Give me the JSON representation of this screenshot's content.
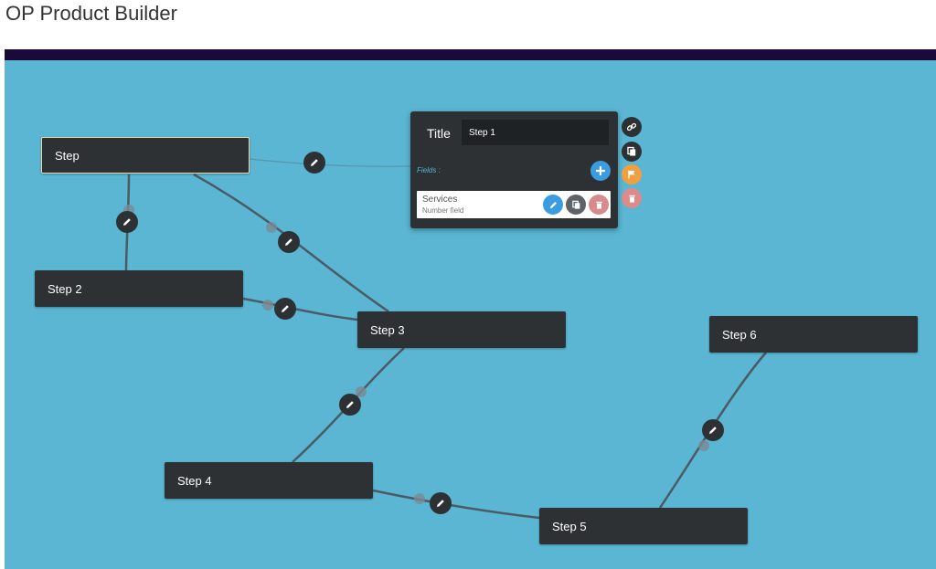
{
  "app": {
    "title": "OP Product Builder"
  },
  "colors": {
    "canvas": "#5ab6d3",
    "topbar": "#1a0a3a",
    "node": "#2d3134",
    "edge": "#4c5a66"
  },
  "nodes": [
    {
      "id": "step",
      "label": "Step",
      "selected": true
    },
    {
      "id": "step-2",
      "label": "Step 2"
    },
    {
      "id": "step-3",
      "label": "Step 3"
    },
    {
      "id": "step-4",
      "label": "Step 4"
    },
    {
      "id": "step-5",
      "label": "Step 5"
    },
    {
      "id": "step-6",
      "label": "Step 6"
    }
  ],
  "edges": [
    {
      "from": "Step",
      "to": "Step 2"
    },
    {
      "from": "Step",
      "to": "Step 3"
    },
    {
      "from": "Step 2",
      "to": "Step 3"
    },
    {
      "from": "Step 3",
      "to": "Step 4"
    },
    {
      "from": "Step 4",
      "to": "Step 5"
    },
    {
      "from": "Step 5",
      "to": "Step 6"
    }
  ],
  "editor": {
    "title_label": "Title",
    "title_value": "Step 1",
    "fields_label": "Fields :",
    "add_icon": "plus-icon",
    "fields": [
      {
        "name": "Services",
        "type": "Number field"
      }
    ],
    "field_actions": [
      {
        "icon": "pencil-icon",
        "color": "#3b9de0"
      },
      {
        "icon": "copy-icon",
        "color": "#5d6367"
      },
      {
        "icon": "trash-icon",
        "color": "#d98a8a"
      }
    ],
    "side_actions": [
      {
        "icon": "link-icon",
        "color": "#2d3134"
      },
      {
        "icon": "copy-icon",
        "color": "#2d3134"
      },
      {
        "icon": "flag-icon",
        "color": "#f0a040"
      },
      {
        "icon": "trash-icon",
        "color": "#dd8a8a"
      }
    ]
  }
}
